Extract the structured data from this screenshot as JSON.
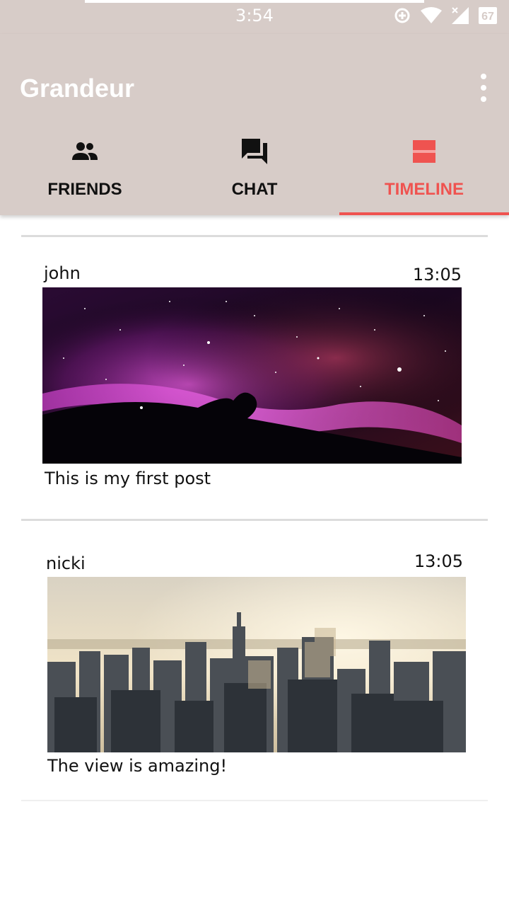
{
  "status_bar": {
    "time": "3:54",
    "battery_level": "67",
    "icons": [
      "data-saver-icon",
      "wifi-icon",
      "cell-signal-icon",
      "battery-icon"
    ]
  },
  "app_bar": {
    "title": "Grandeur",
    "menu_icon": "more-vert-icon",
    "background_color": "#d7ccc8"
  },
  "tabs": [
    {
      "label": "FRIENDS",
      "icon": "people-icon",
      "active": false
    },
    {
      "label": "CHAT",
      "icon": "forum-icon",
      "active": false
    },
    {
      "label": "TIMELINE",
      "icon": "view-stream-icon",
      "active": true
    }
  ],
  "accent_color": "#ef5350",
  "timeline": {
    "posts": [
      {
        "author": "john",
        "time": "13:05",
        "caption": "This is my first post",
        "image": "nebula-photo"
      },
      {
        "author": "nicki",
        "time": "13:05",
        "caption": "The view is amazing!",
        "image": "city-skyline-photo"
      }
    ]
  }
}
